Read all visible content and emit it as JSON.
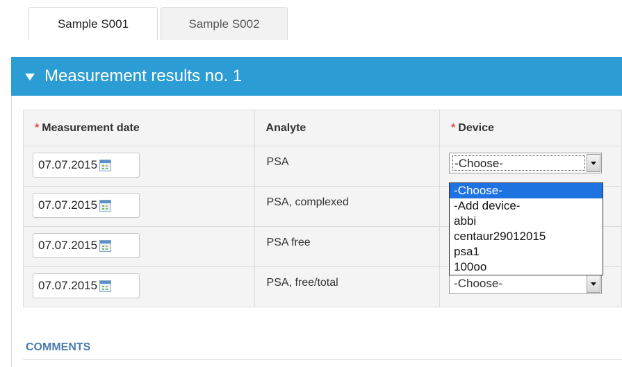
{
  "tabs": [
    {
      "label": "Sample S001",
      "active": true
    },
    {
      "label": "Sample S002",
      "active": false
    }
  ],
  "panel": {
    "title": "Measurement results no. 1",
    "header_color": "#2c9dd4",
    "collapse_icon": "triangle-down-icon"
  },
  "table": {
    "headers": {
      "date": {
        "required_mark": "*",
        "label": "Measurement date"
      },
      "analyte": {
        "label": "Analyte"
      },
      "device": {
        "required_mark": "*",
        "label": "Device"
      }
    },
    "rows": [
      {
        "date": "07.07.2015",
        "analyte": "PSA",
        "device": "-Choose-"
      },
      {
        "date": "07.07.2015",
        "analyte": "PSA, complexed",
        "device": ""
      },
      {
        "date": "07.07.2015",
        "analyte": "PSA free",
        "device": ""
      },
      {
        "date": "07.07.2015",
        "analyte": "PSA, free/total",
        "device": "-Choose-"
      }
    ],
    "calendar_icon": "calendar-icon"
  },
  "device_dropdown": {
    "options": [
      "-Choose-",
      "-Add device-",
      "abbi",
      "centaur29012015",
      "psa1",
      "100oo"
    ],
    "highlighted_option": "-Choose-",
    "highlight_color": "#1e73e0"
  },
  "comments": {
    "label": "COMMENTS"
  },
  "colors": {
    "required": "#d9534f",
    "comments_label": "#4a7cad"
  }
}
